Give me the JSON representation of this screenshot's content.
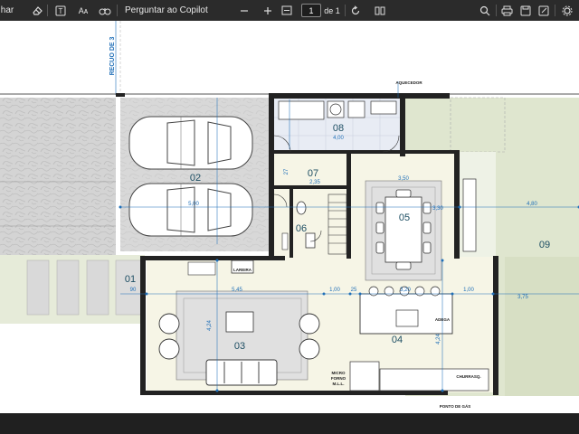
{
  "toolbar": {
    "truncated_label": "har",
    "copilot_prompt": "Perguntar ao Copilot",
    "current_page": "1",
    "page_total": "de 1",
    "text_icon": "Aᴀ"
  },
  "plan": {
    "side_label": "RECUO DE 3",
    "rooms": {
      "r01": "01",
      "r02": "02",
      "r03": "03",
      "r04": "04",
      "r05": "05",
      "r06": "06",
      "r07": "07",
      "r08": "08",
      "r09": "09"
    },
    "labels": {
      "aquecedor": "AQUECEDOR",
      "lareira": "LAREIRA",
      "adega": "ADEGA",
      "churrasq": "CHURRASQ.",
      "ponto_gas": "PONTO DE GÁS",
      "micro1": "MICRO",
      "micro2": "FORNO",
      "micro3": "M.L.L."
    },
    "dims": {
      "d_400": "4,00",
      "d_235": "2,35",
      "d_350": "3,50",
      "d_330": "3,30",
      "d_480": "4,80",
      "d_500": "5,00",
      "d_545": "5,45",
      "d_424a": "4,24",
      "d_424b": "4,24",
      "d_100a": "1,00",
      "d_320": "3,20",
      "d_100b": "1,00",
      "d_375": "3,75",
      "d_90": "90",
      "d_27": "27",
      "d_25": "25"
    }
  },
  "colors": {
    "toolbar_bg": "#2b2b2b",
    "room_label": "#1d4e63",
    "garden": "#dfe6cf",
    "paving": "#d2d2d2",
    "floor": "#f6f5e6",
    "dimension": "#1f6fb8"
  }
}
